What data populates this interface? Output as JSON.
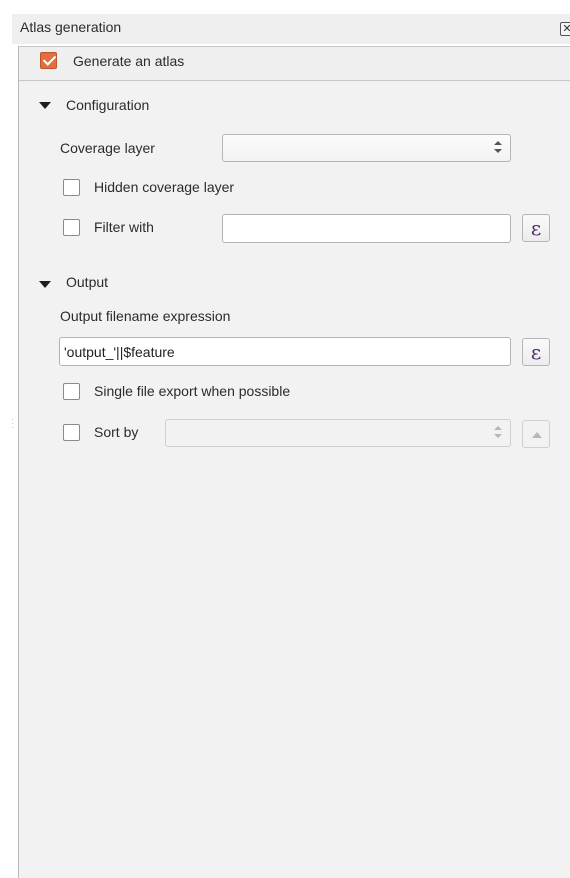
{
  "window": {
    "title": "Atlas generation",
    "close_glyph": "✕"
  },
  "atlas": {
    "enable_label": "Generate an atlas",
    "enabled": true
  },
  "configuration": {
    "section_label": "Configuration",
    "coverage_layer_label": "Coverage layer",
    "coverage_layer_value": "",
    "hidden_coverage_label": "Hidden coverage layer",
    "hidden_coverage_checked": false,
    "filter_with_label": "Filter with",
    "filter_with_checked": false,
    "filter_value": ""
  },
  "output": {
    "section_label": "Output",
    "filename_expr_label": "Output filename expression",
    "filename_expr_value": "'output_'||$feature",
    "single_file_label": "Single file export when possible",
    "single_file_checked": false,
    "sort_by_label": "Sort by",
    "sort_by_checked": false,
    "sort_by_value": ""
  },
  "icons": {
    "expression": "ε",
    "collapse": "triangle-down",
    "sort_order": "triangle-up"
  },
  "colors": {
    "accent_checkbox": "#e36f3f",
    "panel_bg": "#efefef"
  }
}
